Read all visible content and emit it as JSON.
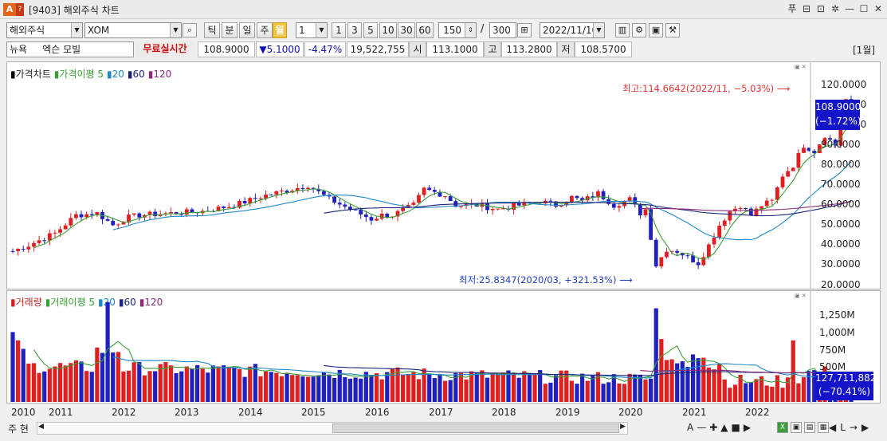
{
  "window": {
    "title": "[9403] 해외주식 차트",
    "logo": "A",
    "logo_sub": "?",
    "controls": [
      "푸",
      "⊟",
      "⊡",
      "✲",
      "—",
      "☐",
      "✕"
    ]
  },
  "toolbar": {
    "market": "해외주식",
    "symbol": "XOM",
    "periods": [
      "틱",
      "분",
      "일",
      "주",
      "월"
    ],
    "active_period": "월",
    "unit_value": "1",
    "multipliers": [
      "1",
      "3",
      "5",
      "10",
      "30",
      "60"
    ],
    "count_visible": "150",
    "count_total": "300",
    "date": "2022/11/10",
    "slash": "/"
  },
  "quote": {
    "exchange": "뉴욕",
    "name": "엑슨 모빌",
    "realtime_label": "무료실시간",
    "price": "108.9000",
    "change": "▼5.1000",
    "change_pct": "-4.47%",
    "volume": "19,522,755",
    "open_label": "시",
    "open": "113.1000",
    "high_label": "고",
    "high": "113.2800",
    "low_label": "저",
    "low": "108.5700",
    "period_tag": "[1월]"
  },
  "price_panel": {
    "legend": [
      {
        "label": "가격차트",
        "color": "#000000"
      },
      {
        "label": "가격이평 5",
        "color": "#3aa036"
      },
      {
        "label": "20",
        "color": "#1e88c8"
      },
      {
        "label": "60",
        "color": "#1b237a"
      },
      {
        "label": "120",
        "color": "#8a2a78"
      }
    ],
    "axis_labels": [
      "120.0000",
      "110.0000",
      "100.0000",
      "90.0000",
      "80.0000",
      "70.0000",
      "60.0000",
      "50.0000",
      "40.0000",
      "30.0000",
      "20.0000"
    ],
    "current_price": "108.9000",
    "current_change": "(−1.72%)",
    "high_note": "최고:114.6642(2022/11, −5.03%)",
    "low_note": "최저:25.8347(2020/03, +321.53%)"
  },
  "volume_panel": {
    "legend": [
      {
        "label": "거래량",
        "color": "#d02020"
      },
      {
        "label": "거래이평 5",
        "color": "#3aa036"
      },
      {
        "label": "20",
        "color": "#1e88c8"
      },
      {
        "label": "60",
        "color": "#1b237a"
      },
      {
        "label": "120",
        "color": "#8a2a78"
      }
    ],
    "axis_labels": [
      "1,250M",
      "1,000M",
      "750M",
      "500M"
    ],
    "current_volume": "127,711,882",
    "current_change": "(−70.41%)"
  },
  "x_axis": {
    "years": [
      "2010",
      "2011",
      "2012",
      "2013",
      "2014",
      "2015",
      "2016",
      "2017",
      "2018",
      "2019",
      "2020",
      "2021",
      "2022"
    ]
  },
  "bottom": {
    "mode": "주 현",
    "tools": [
      "A",
      "—",
      "✚",
      "▲",
      "■",
      "▶",
      "◀",
      "L",
      "→",
      "▶"
    ]
  },
  "colors": {
    "up": "#e02020",
    "down": "#2020c0",
    "ma5": "#3aa036",
    "ma20": "#1e88c8",
    "ma60": "#1b237a",
    "ma120": "#8a2a78",
    "badge": "#1414c8"
  }
}
